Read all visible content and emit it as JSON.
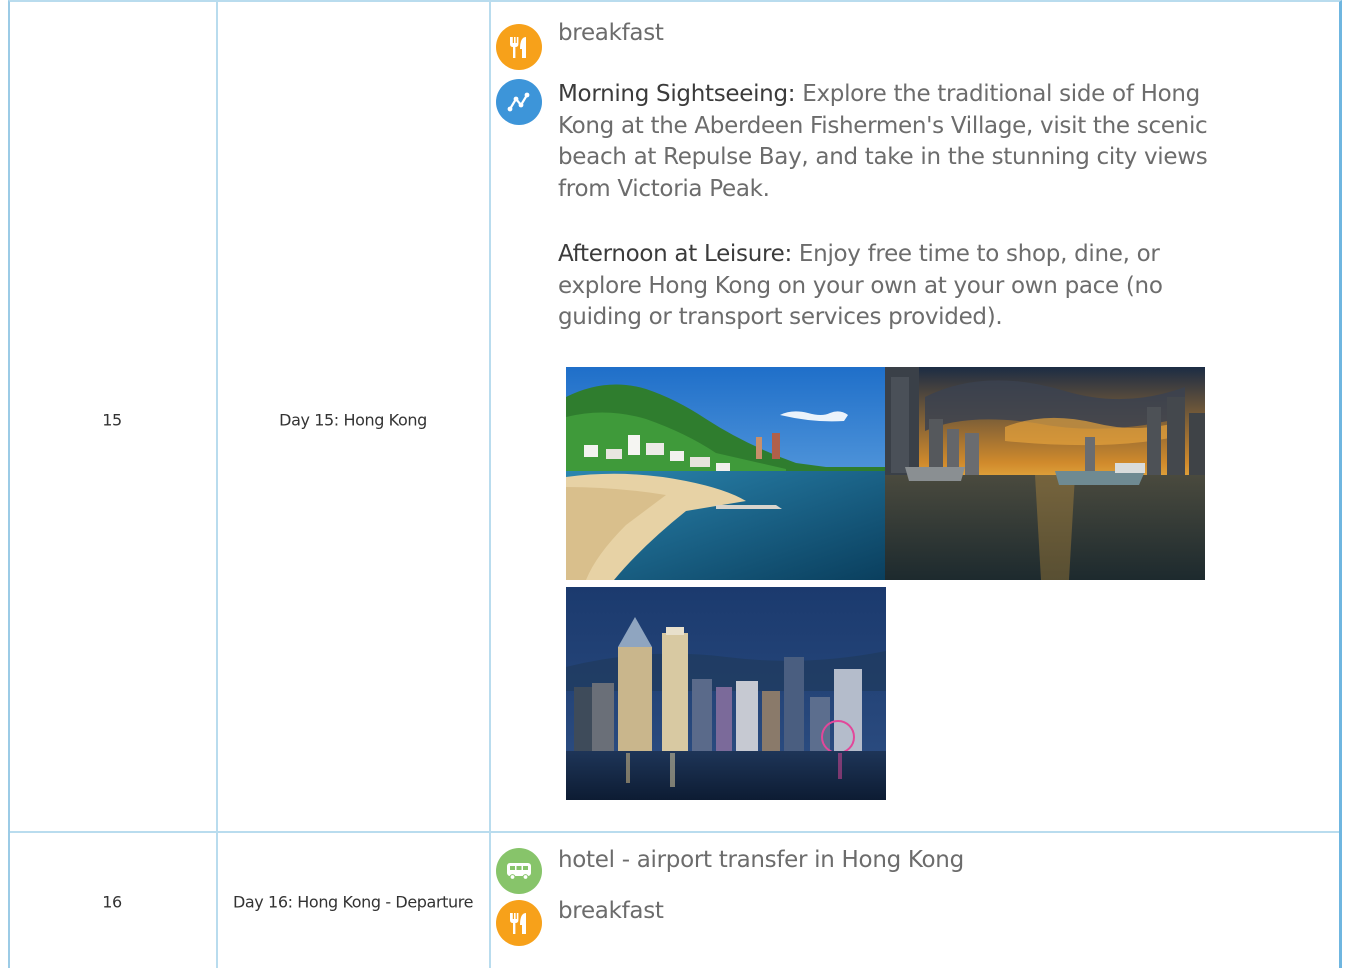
{
  "rows": [
    {
      "number": "15",
      "title": "Day 15: Hong Kong",
      "meal": "breakfast",
      "activities": [
        {
          "lead": "Morning Sightseeing:",
          "text": " Explore the traditional side of Hong Kong at the Aberdeen Fishermen's Village, visit the scenic beach at Repulse Bay, and take in the stunning city views from Victoria Peak."
        },
        {
          "lead": "Afternoon at Leisure:",
          "text": " Enjoy free time to shop, dine, or explore Hong Kong on your own at your own pace (no guiding or transport services provided)."
        }
      ],
      "photos": [
        "repulse-bay-beach",
        "aberdeen-harbour-sunset",
        "victoria-harbour-skyline-night"
      ]
    },
    {
      "number": "16",
      "title": "Day 16: Hong Kong - Departure",
      "transfer": "hotel - airport transfer in Hong Kong",
      "meal": "breakfast"
    }
  ],
  "icons": {
    "meal": "fork-knife-icon",
    "sightseeing": "route-icon",
    "transfer": "bus-icon"
  },
  "colors": {
    "border": "#b9dcee",
    "meal_icon": "#f7a11a",
    "sightseeing_icon": "#3d95d9",
    "transfer_icon": "#87c46a"
  }
}
